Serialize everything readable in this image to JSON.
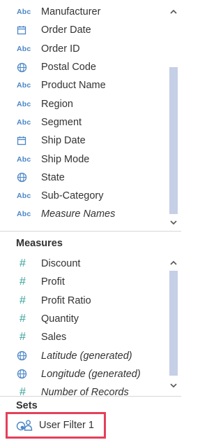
{
  "dimensions": {
    "items": [
      {
        "label": "Manufacturer",
        "icon": "abc-string-icon",
        "italic": false
      },
      {
        "label": "Order Date",
        "icon": "calendar-icon",
        "italic": false
      },
      {
        "label": "Order ID",
        "icon": "abc-string-icon",
        "italic": false
      },
      {
        "label": "Postal Code",
        "icon": "globe-icon",
        "italic": false
      },
      {
        "label": "Product Name",
        "icon": "abc-string-icon",
        "italic": false
      },
      {
        "label": "Region",
        "icon": "abc-string-icon",
        "italic": false
      },
      {
        "label": "Segment",
        "icon": "abc-string-icon",
        "italic": false
      },
      {
        "label": "Ship Date",
        "icon": "calendar-icon",
        "italic": false
      },
      {
        "label": "Ship Mode",
        "icon": "abc-string-icon",
        "italic": false
      },
      {
        "label": "State",
        "icon": "globe-icon",
        "italic": false
      },
      {
        "label": "Sub-Category",
        "icon": "abc-string-icon",
        "italic": false
      },
      {
        "label": "Measure Names",
        "icon": "abc-string-icon",
        "italic": true
      }
    ]
  },
  "measures": {
    "title": "Measures",
    "items": [
      {
        "label": "Discount",
        "icon": "hash-number-icon",
        "italic": false
      },
      {
        "label": "Profit",
        "icon": "hash-number-icon",
        "italic": false
      },
      {
        "label": "Profit Ratio",
        "icon": "hash-number-icon",
        "italic": false
      },
      {
        "label": "Quantity",
        "icon": "hash-number-icon",
        "italic": false
      },
      {
        "label": "Sales",
        "icon": "hash-number-icon",
        "italic": false
      },
      {
        "label": "Latitude (generated)",
        "icon": "globe-icon",
        "italic": true
      },
      {
        "label": "Longitude (generated)",
        "icon": "globe-icon",
        "italic": true
      },
      {
        "label": "Number of Records",
        "icon": "hash-number-icon",
        "italic": true
      }
    ]
  },
  "sets": {
    "title": "Sets",
    "items": [
      {
        "label": "User Filter 1",
        "icon": "set-icon",
        "highlighted": true
      }
    ]
  },
  "glyphs": {
    "abc": "Abc",
    "hash": "#"
  },
  "colors": {
    "dimension_icon": "#4c86c6",
    "measure_icon": "#3aa39a",
    "scroll_thumb": "#c5cfe6",
    "highlight_border": "#e4405b"
  }
}
